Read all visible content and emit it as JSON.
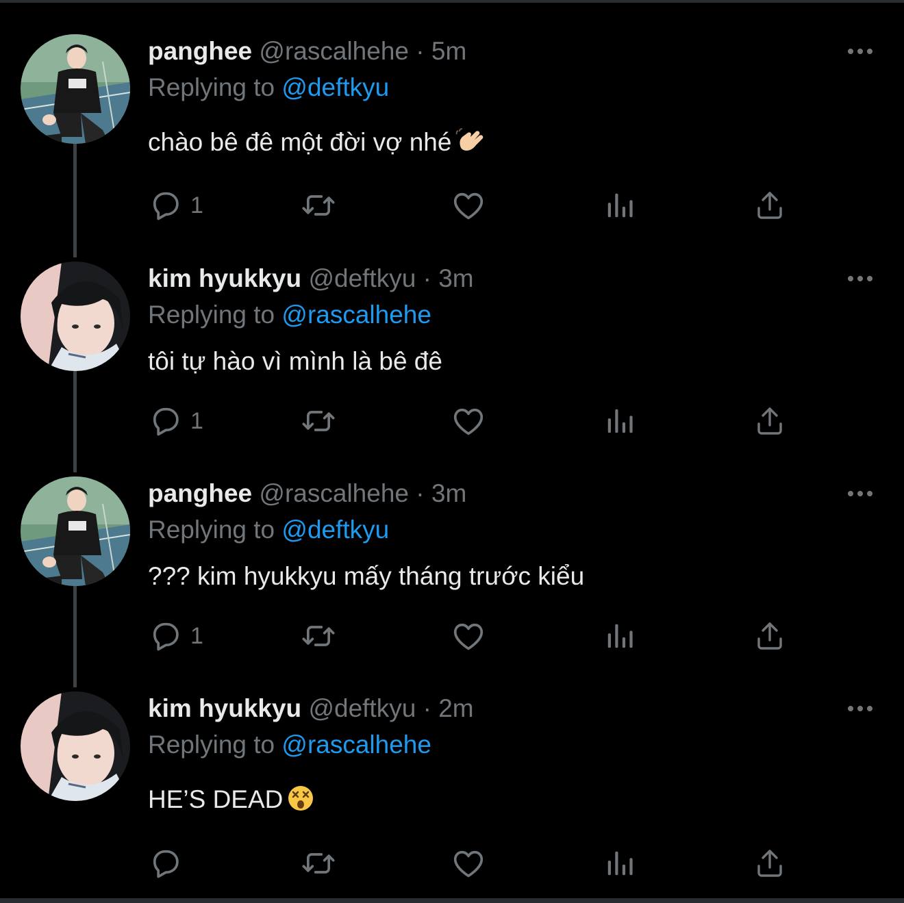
{
  "tweets": [
    {
      "name": "panghee",
      "handle": "@rascalhehe",
      "separator": "·",
      "time": "5m",
      "replying_prefix": "Replying to",
      "replying_to": "@deftkyu",
      "text": "chào bê đê một đời vợ nhé",
      "emoji": "waving-hand",
      "reply_count": "1"
    },
    {
      "name": "kim hyukkyu",
      "handle": "@deftkyu",
      "separator": "·",
      "time": "3m",
      "replying_prefix": "Replying to",
      "replying_to": "@rascalhehe",
      "text": "tôi tự hào vì mình là bê đê",
      "reply_count": "1"
    },
    {
      "name": "panghee",
      "handle": "@rascalhehe",
      "separator": "·",
      "time": "3m",
      "replying_prefix": "Replying to",
      "replying_to": "@deftkyu",
      "text": "??? kim hyukkyu mấy tháng trước kiểu",
      "reply_count": "1"
    },
    {
      "name": "kim hyukkyu",
      "handle": "@deftkyu",
      "separator": "·",
      "time": "2m",
      "replying_prefix": "Replying to",
      "replying_to": "@rascalhehe",
      "text": "HE’S DEAD",
      "emoji": "dizzy-face",
      "reply_count": ""
    }
  ],
  "icons": {
    "reply": "reply-icon",
    "retweet": "retweet-icon",
    "like": "heart-icon",
    "views": "views-icon",
    "share": "share-icon",
    "more": "more-icon"
  },
  "colors": {
    "background": "#000000",
    "text": "#e7e9ea",
    "muted": "#71767b",
    "link": "#1d9bf0",
    "thread_line": "#3e4144"
  }
}
